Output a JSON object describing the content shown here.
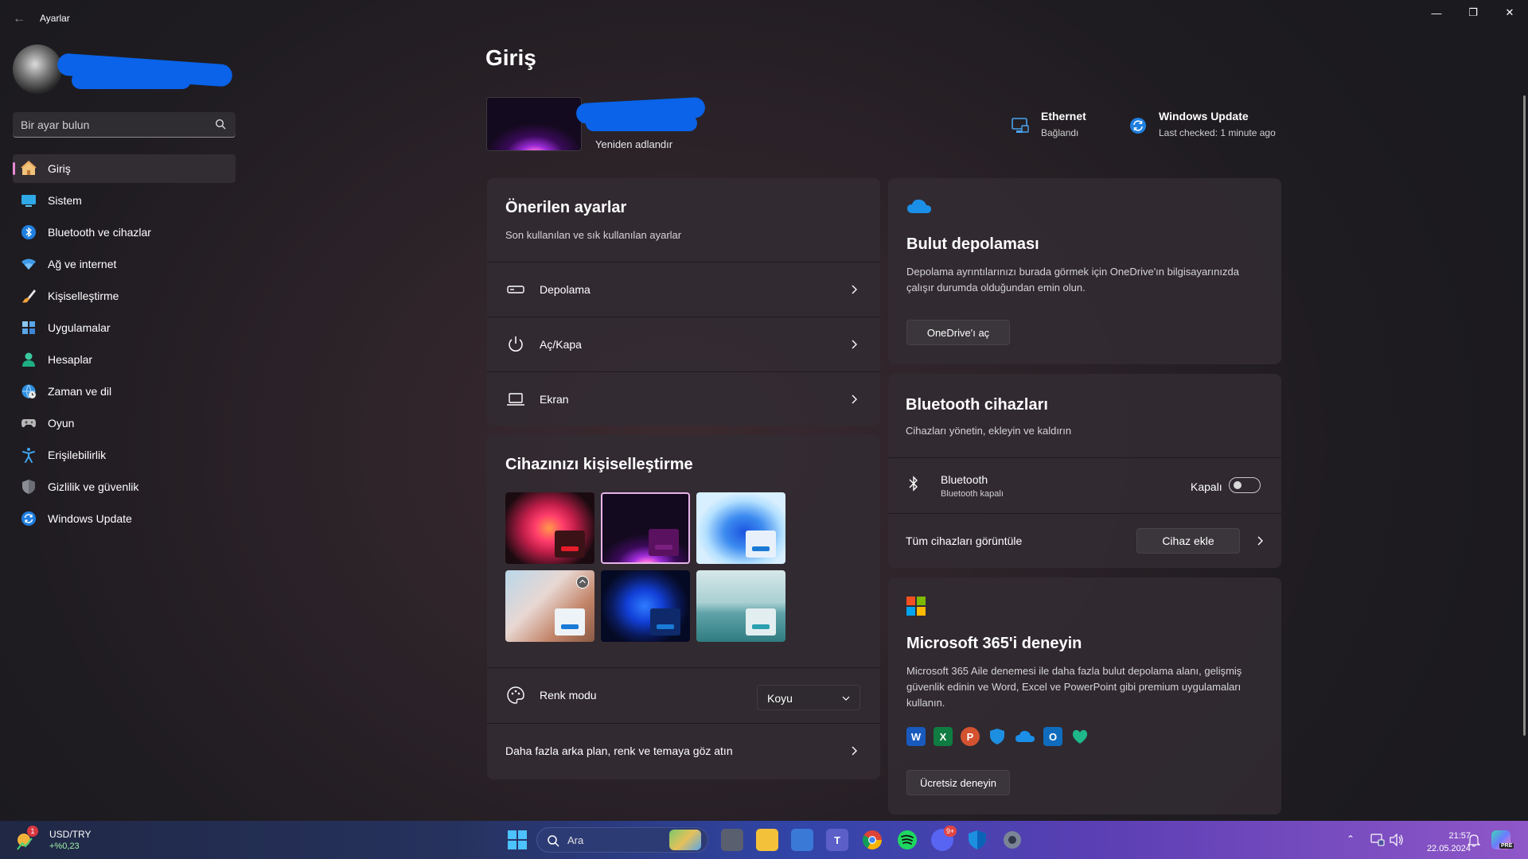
{
  "app": {
    "title": "Ayarlar"
  },
  "search": {
    "placeholder": "Bir ayar bulun"
  },
  "sidebar": {
    "items": [
      {
        "label": "Giriş",
        "icon": "home-icon",
        "active": true
      },
      {
        "label": "Sistem",
        "icon": "monitor-icon"
      },
      {
        "label": "Bluetooth ve cihazlar",
        "icon": "bluetooth-icon"
      },
      {
        "label": "Ağ ve internet",
        "icon": "wifi-icon"
      },
      {
        "label": "Kişiselleştirme",
        "icon": "brush-icon"
      },
      {
        "label": "Uygulamalar",
        "icon": "apps-icon"
      },
      {
        "label": "Hesaplar",
        "icon": "person-icon"
      },
      {
        "label": "Zaman ve dil",
        "icon": "globe-clock-icon"
      },
      {
        "label": "Oyun",
        "icon": "gamepad-icon"
      },
      {
        "label": "Erişilebilirlik",
        "icon": "accessibility-icon"
      },
      {
        "label": "Gizlilik ve güvenlik",
        "icon": "shield-icon"
      },
      {
        "label": "Windows Update",
        "icon": "update-icon"
      }
    ]
  },
  "main": {
    "title": "Giriş",
    "device": {
      "rename_label": "Yeniden adlandır"
    },
    "status": {
      "ethernet": {
        "title": "Ethernet",
        "sub": "Bağlandı"
      },
      "update": {
        "title": "Windows Update",
        "sub": "Last checked: 1 minute ago"
      }
    },
    "recommended": {
      "title": "Önerilen ayarlar",
      "subtitle": "Son kullanılan ve sık kullanılan ayarlar",
      "rows": [
        {
          "label": "Depolama",
          "icon": "storage-icon"
        },
        {
          "label": "Aç/Kapa",
          "icon": "power-icon"
        },
        {
          "label": "Ekran",
          "icon": "laptop-icon"
        }
      ]
    },
    "personalize": {
      "title": "Cihazınızı kişiselleştirme",
      "color_mode_label": "Renk modu",
      "color_mode_value": "Koyu",
      "more_label": "Daha fazla arka plan, renk ve temaya göz atın"
    },
    "cloud": {
      "title": "Bulut depolaması",
      "text": "Depolama ayrıntılarınızı burada görmek için OneDrive'ın bilgisayarınızda çalışır durumda olduğundan emin olun.",
      "button": "OneDrive'ı aç"
    },
    "bluetooth": {
      "title": "Bluetooth cihazları",
      "subtitle": "Cihazları yönetin, ekleyin ve kaldırın",
      "device_label": "Bluetooth",
      "device_sub": "Bluetooth kapalı",
      "toggle_label": "Kapalı",
      "toggle_on": false,
      "view_all": "Tüm cihazları görüntüle",
      "add_button": "Cihaz ekle"
    },
    "m365": {
      "title": "Microsoft 365'i deneyin",
      "text": "Microsoft 365 Aile denemesi ile daha fazla bulut depolama alanı, gelişmiş güvenlik edinin ve Word, Excel ve PowerPoint gibi premium uygulamaları kullanın.",
      "button": "Ücretsiz deneyin",
      "apps": [
        "word-icon",
        "excel-icon",
        "powerpoint-icon",
        "defender-icon",
        "onedrive-icon",
        "outlook-icon",
        "family-icon"
      ]
    }
  },
  "taskbar": {
    "widget": {
      "title": "USD/TRY",
      "value": "+%0,23",
      "badge": "1"
    },
    "search_label": "Ara",
    "time": "21:57",
    "date": "22.05.2024",
    "discord_badge": "9+",
    "copilot_badge": "PRE"
  },
  "colors": {
    "accent_pink": "#e88ad3",
    "accent_blue": "#0a63e8"
  }
}
